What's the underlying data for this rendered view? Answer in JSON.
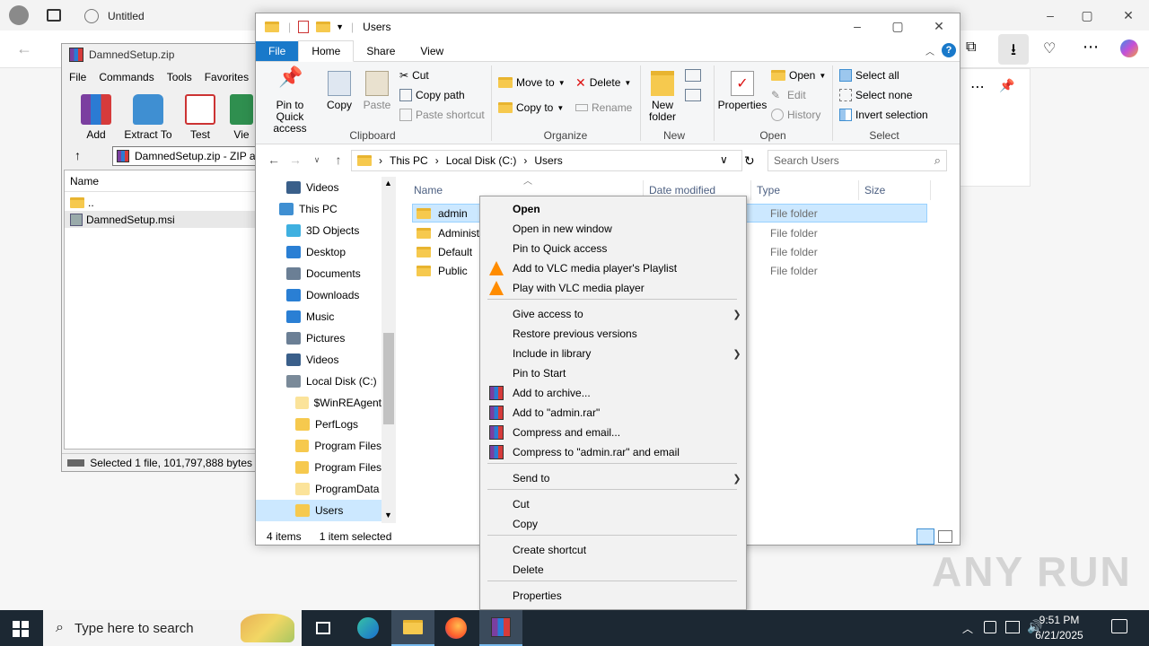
{
  "browser": {
    "tab_title": "Untitled",
    "window_controls": [
      "–",
      "▢",
      "✕"
    ]
  },
  "winrar": {
    "title": "DamnedSetup.zip",
    "menu": [
      "File",
      "Commands",
      "Tools",
      "Favorites"
    ],
    "toolbar": [
      "Add",
      "Extract To",
      "Test",
      "Vie"
    ],
    "path": "DamnedSetup.zip - ZIP ar",
    "column_name": "Name",
    "rows": [
      "..",
      "DamnedSetup.msi"
    ],
    "status": "Selected 1 file, 101,797,888 bytes"
  },
  "explorer": {
    "title": "Users",
    "tabs": [
      "File",
      "Home",
      "Share",
      "View"
    ],
    "clipboard": {
      "pin": "Pin to Quick access",
      "copy": "Copy",
      "paste": "Paste",
      "cut": "Cut",
      "copy_path": "Copy path",
      "paste_shortcut": "Paste shortcut",
      "label": "Clipboard"
    },
    "organize": {
      "move_to": "Move to",
      "copy_to": "Copy to",
      "delete": "Delete",
      "rename": "Rename",
      "label": "Organize"
    },
    "new": {
      "new_folder": "New folder",
      "label": "New"
    },
    "open": {
      "properties": "Properties",
      "open": "Open",
      "edit": "Edit",
      "history": "History",
      "label": "Open"
    },
    "select": {
      "select_all": "Select all",
      "select_none": "Select none",
      "invert": "Invert selection",
      "label": "Select"
    },
    "breadcrumb": [
      "This PC",
      "Local Disk (C:)",
      "Users"
    ],
    "search_placeholder": "Search Users",
    "nav": [
      {
        "label": "Videos",
        "color": "#3a5f8a"
      },
      {
        "label": "This PC",
        "color": "#3f8fd2"
      },
      {
        "label": "3D Objects",
        "color": "#3fb0e0"
      },
      {
        "label": "Desktop",
        "color": "#2a7fd4"
      },
      {
        "label": "Documents",
        "color": "#6b7f95"
      },
      {
        "label": "Downloads",
        "color": "#2a7fd4"
      },
      {
        "label": "Music",
        "color": "#2a7fd4"
      },
      {
        "label": "Pictures",
        "color": "#6b7f95"
      },
      {
        "label": "Videos",
        "color": "#3a5f8a"
      },
      {
        "label": "Local Disk (C:)",
        "color": "#7a8a99"
      },
      {
        "label": "$WinREAgent",
        "color": "#fbe39a"
      },
      {
        "label": "PerfLogs",
        "color": "#f6c94e"
      },
      {
        "label": "Program Files",
        "color": "#f6c94e"
      },
      {
        "label": "Program Files",
        "color": "#f6c94e"
      },
      {
        "label": "ProgramData",
        "color": "#fbe39a"
      },
      {
        "label": "Users",
        "color": "#f6c94e"
      }
    ],
    "columns": [
      "Name",
      "Date modified",
      "Type",
      "Size"
    ],
    "files": [
      {
        "name": "admin",
        "type": "File folder"
      },
      {
        "name": "Administ",
        "type": "File folder"
      },
      {
        "name": "Default",
        "type": "File folder"
      },
      {
        "name": "Public",
        "type": "File folder"
      }
    ],
    "status_count": "4 items",
    "status_selected": "1 item selected"
  },
  "context_menu": {
    "items": [
      {
        "label": "Open",
        "icon": "",
        "bold": true
      },
      {
        "label": "Open in new window",
        "icon": ""
      },
      {
        "label": "Pin to Quick access",
        "icon": ""
      },
      {
        "label": "Add to VLC media player's Playlist",
        "icon": "vlc-icon"
      },
      {
        "label": "Play with VLC media player",
        "icon": "vlc-icon"
      },
      {
        "label": "Give access to",
        "icon": "",
        "submenu": true
      },
      {
        "label": "Restore previous versions",
        "icon": ""
      },
      {
        "label": "Include in library",
        "icon": "",
        "submenu": true
      },
      {
        "label": "Pin to Start",
        "icon": ""
      },
      {
        "label": "Add to archive...",
        "icon": "winrar-icon"
      },
      {
        "label": "Add to \"admin.rar\"",
        "icon": "winrar-icon"
      },
      {
        "label": "Compress and email...",
        "icon": "winrar-icon"
      },
      {
        "label": "Compress to \"admin.rar\" and email",
        "icon": "winrar-icon"
      },
      {
        "label": "Send to",
        "icon": "",
        "submenu": true
      },
      {
        "label": "Cut",
        "icon": ""
      },
      {
        "label": "Copy",
        "icon": ""
      },
      {
        "label": "Create shortcut",
        "icon": ""
      },
      {
        "label": "Delete",
        "icon": ""
      },
      {
        "label": "Properties",
        "icon": ""
      }
    ]
  },
  "taskbar": {
    "search_placeholder": "Type here to search",
    "time": "9:51 PM",
    "date": "6/21/2025"
  },
  "watermark": "ANY RUN",
  "colors": {
    "accent": "#1979ca",
    "selection": "#cce8ff",
    "taskbar": "#1c2833"
  }
}
